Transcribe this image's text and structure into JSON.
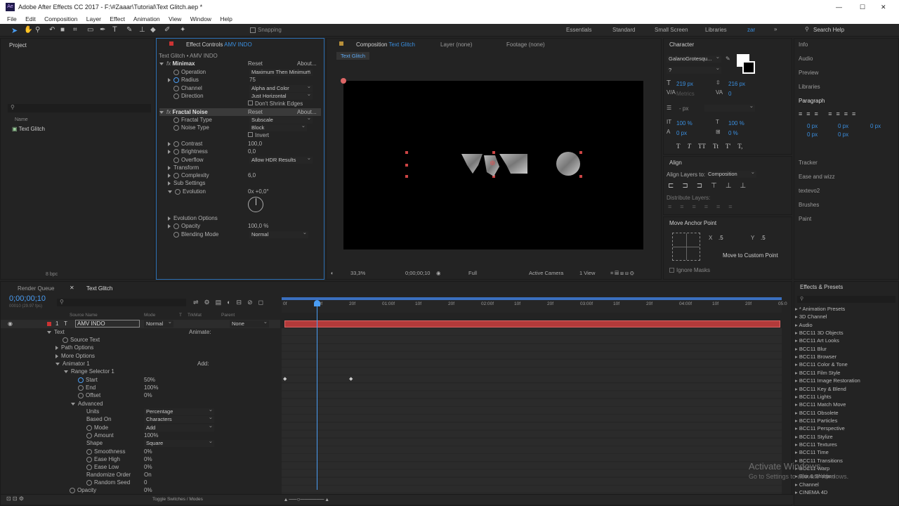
{
  "window": {
    "title": "Adobe After Effects CC 2017 - F:\\#Zaaar\\Tutorial\\Text Glitch.aep *",
    "app_badge": "Ae",
    "min": "—",
    "max": "☐",
    "close": "✕"
  },
  "menu": [
    "File",
    "Edit",
    "Composition",
    "Layer",
    "Effect",
    "Animation",
    "View",
    "Window",
    "Help"
  ],
  "toolbar": {
    "snapping": "Snapping",
    "workspaces": [
      "Essentials",
      "Standard",
      "Small Screen",
      "Libraries",
      "zar"
    ],
    "search_placeholder": "Search Help"
  },
  "project": {
    "title": "Project",
    "col_name": "Name",
    "item": "Text Glitch",
    "bpc": "8 bpc"
  },
  "effect_controls": {
    "title": "Effect Controls",
    "layer": "AMV INDO",
    "subtitle": "Text Glitch • AMV INDO",
    "minimax": {
      "name": "Minimax",
      "reset": "Reset",
      "about": "About...",
      "operation_label": "Operation",
      "operation": "Maximum Then Minimum",
      "radius_label": "Radius",
      "radius": "75",
      "channel_label": "Channel",
      "channel": "Alpha and Color",
      "direction_label": "Direction",
      "direction": "Just Horizontal",
      "dont_shrink": "Don't Shrink Edges"
    },
    "fractal": {
      "name": "Fractal Noise",
      "reset": "Reset",
      "about": "About...",
      "type_label": "Fractal Type",
      "type": "Subscale",
      "noise_label": "Noise Type",
      "noise": "Block",
      "invert": "Invert",
      "contrast_label": "Contrast",
      "contrast": "100,0",
      "brightness_label": "Brightness",
      "brightness": "0,0",
      "overflow_label": "Overflow",
      "overflow": "Allow HDR Results",
      "transform": "Transform",
      "complexity_label": "Complexity",
      "complexity": "6,0",
      "sub_settings": "Sub Settings",
      "evolution_label": "Evolution",
      "evolution": "0x +0,0°",
      "evo_options": "Evolution Options",
      "opacity_label": "Opacity",
      "opacity": "100,0 %",
      "blend_label": "Blending Mode",
      "blend": "Normal"
    }
  },
  "composition": {
    "tab": "Composition",
    "tab_name": "Text Glitch",
    "layer_tab": "Layer (none)",
    "footage_tab": "Footage (none)",
    "breadcrumb": "Text Glitch",
    "zoom": "33,3%",
    "time": "0;00;00;10",
    "resolution": "Full",
    "camera": "Active Camera",
    "views": "1 View"
  },
  "character": {
    "title": "Character",
    "font": "GalanoGrotesqu...",
    "style": "?",
    "size": "219 px",
    "leading": "216 px",
    "kerning": "Metrics",
    "tracking": "0",
    "stroke_width": "- px",
    "vscale": "100 %",
    "hscale": "100 %",
    "baseline": "0 px",
    "tsume": "0 %",
    "styles": [
      "T",
      "T",
      "TT",
      "Tt",
      "T'",
      "T,"
    ]
  },
  "align": {
    "title": "Align",
    "align_to_label": "Align Layers to:",
    "align_to": "Composition",
    "distribute": "Distribute Layers:"
  },
  "anchor": {
    "title": "Move Anchor Point",
    "x_label": "X",
    "x": ".5",
    "y_label": "Y",
    "y": ".5",
    "custom": "Move to Custom Point",
    "ignore": "Ignore Masks"
  },
  "right_panels": [
    "Info",
    "Audio",
    "Preview",
    "Libraries"
  ],
  "paragraph": {
    "title": "Paragraph",
    "indents": [
      "0 px",
      "0 px",
      "0 px",
      "0 px",
      "0 px"
    ]
  },
  "right_panels2": [
    "Tracker",
    "Ease and wizz",
    "textevo2",
    "Brushes",
    "Paint"
  ],
  "timeline": {
    "render_queue": "Render Queue",
    "tab": "Text Glitch",
    "timecode": "0;00;00;10",
    "fps": "00010 (29.97 fps)",
    "cols": {
      "source": "Source Name",
      "mode": "Mode",
      "t": "T",
      "trkmat": "TrkMat",
      "parent": "Parent"
    },
    "layer": {
      "num": "1",
      "name": "AMV INDO",
      "mode": "Normal",
      "parent": "None"
    },
    "ruler": [
      "0f",
      "10f",
      "20f",
      "01:00f",
      "10f",
      "20f",
      "02:00f",
      "10f",
      "20f",
      "03:00f",
      "10f",
      "20f",
      "04:00f",
      "10f",
      "20f",
      "05:0"
    ],
    "rows": {
      "text": "Text",
      "animate": "Animate:",
      "source_text": "Source Text",
      "path": "Path Options",
      "more": "More Options",
      "animator": "Animator 1",
      "add": "Add:",
      "range": "Range Selector 1",
      "start": "Start",
      "start_v": "50%",
      "end": "End",
      "end_v": "100%",
      "offset": "Offset",
      "offset_v": "0%",
      "advanced": "Advanced",
      "units": "Units",
      "units_v": "Percentage",
      "based": "Based On",
      "based_v": "Characters",
      "mode": "Mode",
      "mode_v": "Add",
      "amount": "Amount",
      "amount_v": "100%",
      "shape": "Shape",
      "shape_v": "Square",
      "smooth": "Smoothness",
      "smooth_v": "0%",
      "ehigh": "Ease High",
      "ehigh_v": "0%",
      "elow": "Ease Low",
      "elow_v": "0%",
      "rorder": "Randomize Order",
      "rorder_v": "On",
      "rseed": "Random Seed",
      "rseed_v": "0",
      "opacity": "Opacity",
      "opacity_v": "0%"
    },
    "toggle": "Toggle Switches / Modes"
  },
  "effects_presets": {
    "title": "Effects & Presets",
    "items": [
      "* Animation Presets",
      "3D Channel",
      "Audio",
      "BCC11 3D Objects",
      "BCC11 Art Looks",
      "BCC11 Blur",
      "BCC11 Browser",
      "BCC11 Color & Tone",
      "BCC11 Film Style",
      "BCC11 Image Restoration",
      "BCC11 Key & Blend",
      "BCC11 Lights",
      "BCC11 Match Move",
      "BCC11 Obsolete",
      "BCC11 Particles",
      "BCC11 Perspective",
      "BCC11 Stylize",
      "BCC11 Textures",
      "BCC11 Time",
      "BCC11 Transitions",
      "BCC11 Warp",
      "Blur & Sharpen",
      "Channel",
      "CINEMA 4D"
    ]
  },
  "watermark": {
    "line1": "Activate Windows",
    "line2": "Go to Settings to activate Windows."
  }
}
